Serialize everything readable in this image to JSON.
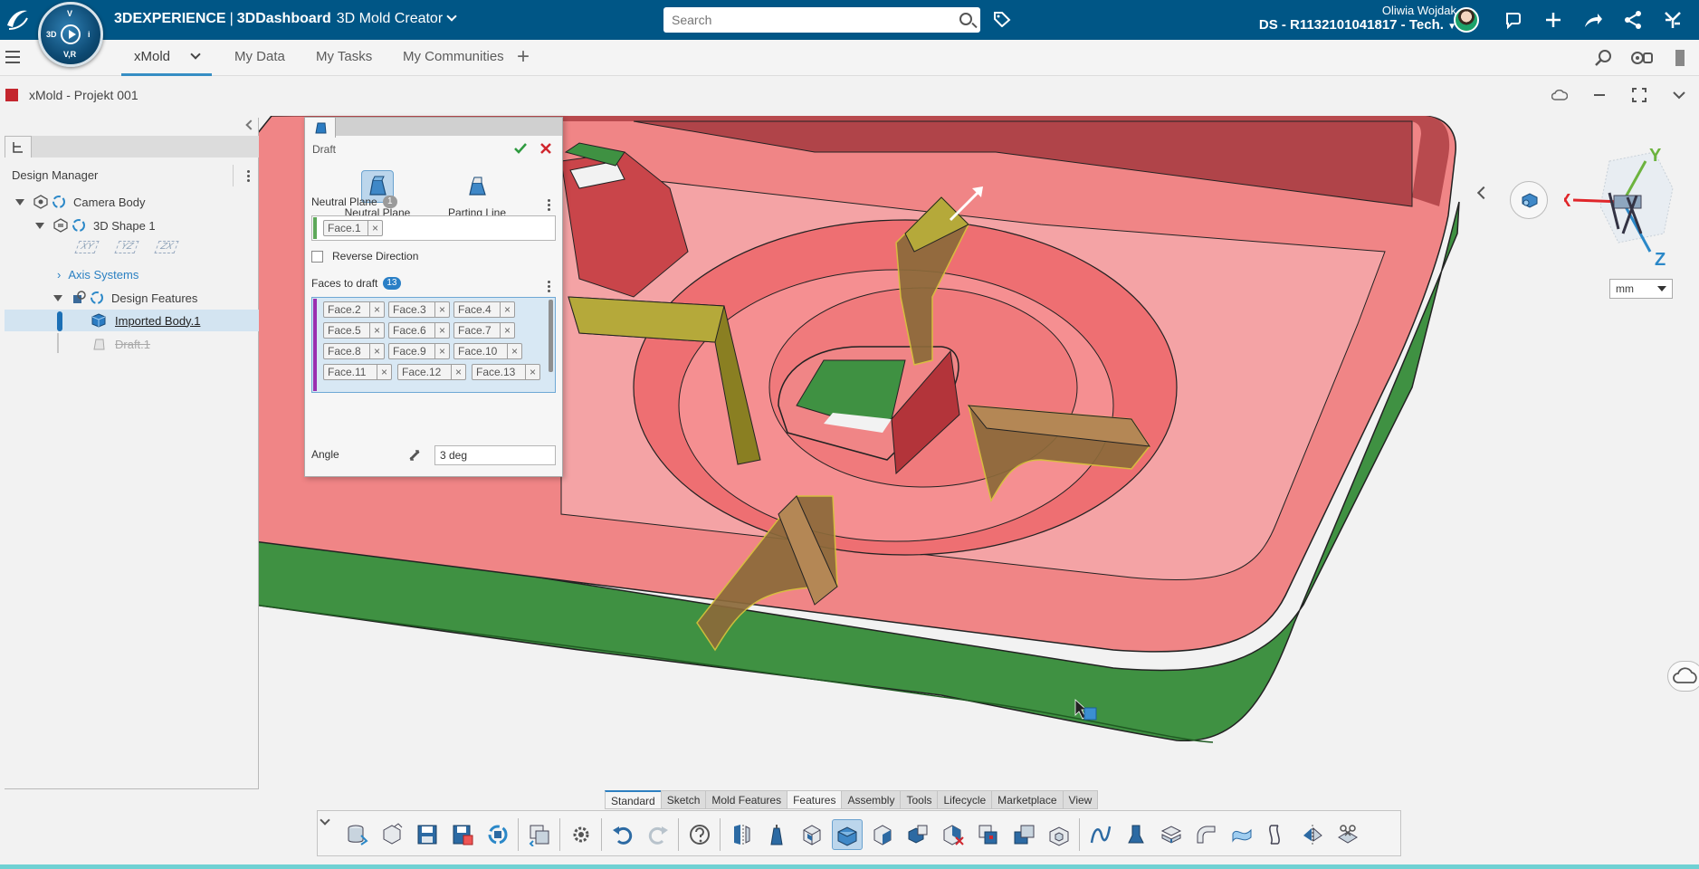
{
  "topbar": {
    "brand_1": "3DEXPERIENCE",
    "brand_sep": "|",
    "brand_2": "3DDashboard",
    "app_name": "3D Mold Creator",
    "search_placeholder": "Search",
    "user_name": "Oliwia Wojdak",
    "tenant": "DS - R1132101041817 - Tech.",
    "compass_labels": {
      "top": "V",
      "left": "3D",
      "right": "i",
      "bottom": "V,R"
    },
    "icons": [
      "tag-icon",
      "notification-icon",
      "add-icon",
      "share-icon",
      "network-icon",
      "apps-icon"
    ]
  },
  "tabs": {
    "items": [
      "xMold",
      "My Data",
      "My Tasks",
      "My Communities"
    ],
    "add_label": "+"
  },
  "window": {
    "title": "xMold - Projekt 001"
  },
  "tree": {
    "panel_title": "Design Manager",
    "root": "Camera Body",
    "shape": "3D Shape 1",
    "planes": [
      "XY",
      "YZ",
      "ZX"
    ],
    "axis_systems": "Axis Systems",
    "design_features": "Design Features",
    "imported_body": "Imported Body.1",
    "draft": "Draft.1"
  },
  "dialog": {
    "title": "Draft",
    "modes": [
      "Neutral Plane",
      "Parting Line"
    ],
    "neutral_plane_label": "Neutral Plane",
    "neutral_plane_count": "1",
    "neutral_faces": [
      "Face.1"
    ],
    "reverse_direction_label": "Reverse Direction",
    "faces_to_draft_label": "Faces to draft",
    "faces_to_draft_count": "13",
    "faces": [
      "Face.2",
      "Face.3",
      "Face.4",
      "Face.5",
      "Face.6",
      "Face.7",
      "Face.8",
      "Face.9",
      "Face.10",
      "Face.11",
      "Face.12",
      "Face.13"
    ],
    "angle_label": "Angle",
    "angle_value": "3 deg",
    "remove_glyph": "×"
  },
  "viewport": {
    "axis_x": "X",
    "axis_y": "Y",
    "axis_z": "Z",
    "unit": "mm",
    "colors": {
      "part_pink": "#f08586",
      "part_green": "#3f9142",
      "selection_olive": "#b5a93a"
    }
  },
  "actionbar": {
    "tabs": [
      "Standard",
      "Sketch",
      "Mold Features",
      "Features",
      "Assembly",
      "Tools",
      "Lifecycle",
      "Marketplace",
      "View"
    ],
    "active_tab": "Standard"
  },
  "colors": {
    "topbar": "#005686",
    "accent": "#368ec4",
    "bottom_strip": "#6fd1d3"
  }
}
